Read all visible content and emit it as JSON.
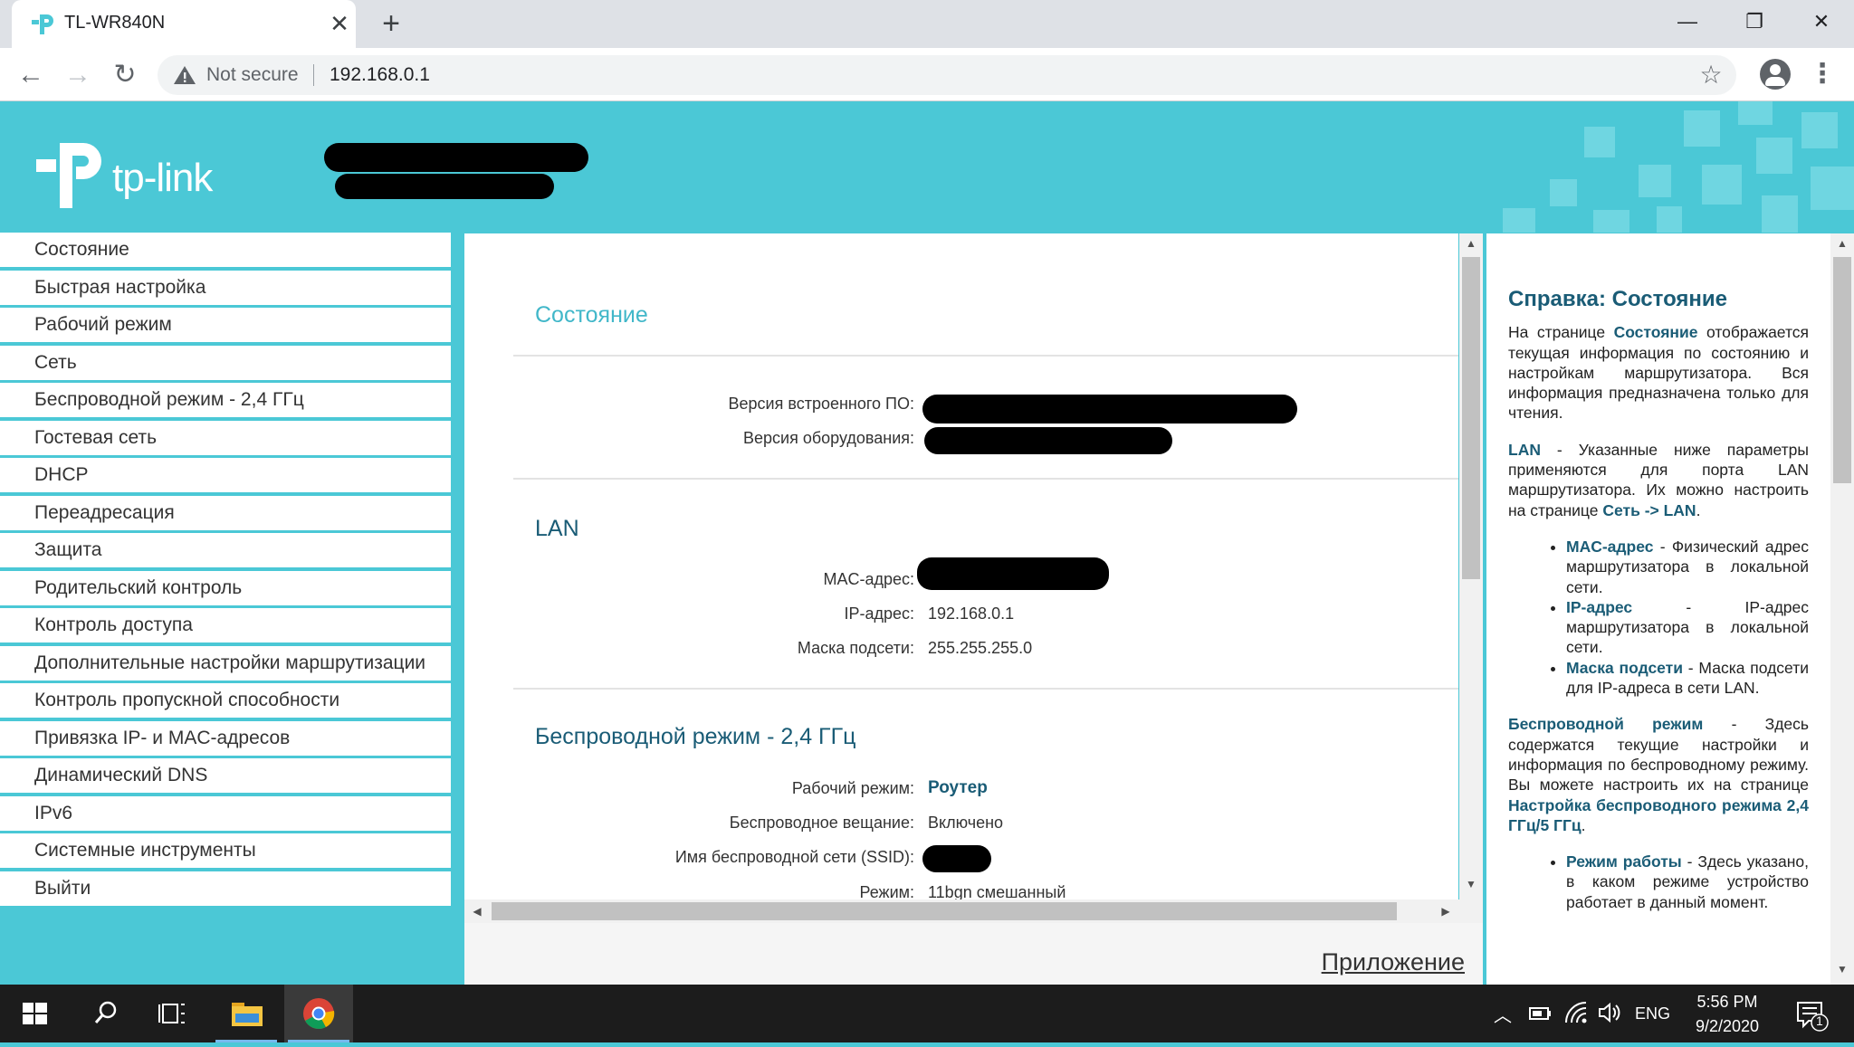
{
  "browser": {
    "tab_title": "TL-WR840N",
    "tab_close": "✕",
    "new_tab": "+",
    "security_label": "Not secure",
    "url": "192.168.0.1",
    "window_minimize": "—",
    "window_restore": "❐",
    "window_close": "✕"
  },
  "header": {
    "logo_text": "tp-link"
  },
  "sidebar": {
    "items": [
      {
        "label": "Состояние"
      },
      {
        "label": "Быстрая настройка"
      },
      {
        "label": "Рабочий режим"
      },
      {
        "label": "Сеть"
      },
      {
        "label": "Беспроводной режим - 2,4 ГГц"
      },
      {
        "label": "Гостевая сеть"
      },
      {
        "label": "DHCP"
      },
      {
        "label": "Переадресация"
      },
      {
        "label": "Защита"
      },
      {
        "label": "Родительский контроль"
      },
      {
        "label": "Контроль доступа"
      },
      {
        "label": "Дополнительные настройки маршрутизации"
      },
      {
        "label": "Контроль пропускной способности"
      },
      {
        "label": "Привязка IP- и MAC-адресов"
      },
      {
        "label": "Динамический DNS"
      },
      {
        "label": "IPv6"
      },
      {
        "label": "Системные инструменты"
      },
      {
        "label": "Выйти"
      }
    ]
  },
  "content": {
    "status_title": "Состояние",
    "firmware_label": "Версия встроенного ПО:",
    "hardware_label": "Версия оборудования:",
    "lan_title": "LAN",
    "mac_label": "MAC-адрес:",
    "ip_label": "IP-адрес:",
    "ip_value": "192.168.0.1",
    "mask_label": "Маска подсети:",
    "mask_value": "255.255.255.0",
    "wireless_title": "Беспроводной режим - 2,4 ГГц",
    "mode_label": "Рабочий режим:",
    "mode_value": "Роутер",
    "broadcast_label": "Беспроводное вещание:",
    "broadcast_value": "Включено",
    "ssid_label": "Имя беспроводной сети (SSID):",
    "wmode_label": "Режим:",
    "wmode_value": "11bgn смешанный",
    "appendix": "Приложение"
  },
  "help": {
    "title": "Справка: Состояние",
    "p1_a": "На странице ",
    "p1_b": "Состояние",
    "p1_c": " отображается текущая информация по состоянию и настройкам маршрутизатора. Вся информация предназначена только для чтения.",
    "p2_a": "LAN",
    "p2_b": " - Указанные ниже параметры применяются для порта LAN маршрутизатора. Их можно настроить на странице ",
    "p2_c": "Сеть -> LAN",
    "p2_d": ".",
    "li1_a": "MAC-адрес",
    "li1_b": " - Физический адрес маршрутизатора в локальной сети.",
    "li2_a": "IP-адрес",
    "li2_b": " - IP-адрес маршрутизатора в локальной сети.",
    "li3_a": "Маска подсети",
    "li3_b": " - Маска подсети для IP-адреса в сети LAN.",
    "p3_a": "Беспроводной режим",
    "p3_b": " - Здесь содержатся текущие настройки и информация по беспроводному режиму. Вы можете настроить их на странице ",
    "p3_c": "Настройка беспроводного режима 2,4 ГГц/5 ГГц",
    "p3_d": ".",
    "li4_a": "Режим работы",
    "li4_b": " - Здесь указано, в каком режиме устройство работает в данный момент."
  },
  "taskbar": {
    "lang": "ENG",
    "time": "5:56 PM",
    "date": "9/2/2020",
    "notif_count": "1"
  },
  "colors": {
    "brand_teal": "#4bc8d6",
    "heading_dark": "#1a5c76",
    "heading_accent": "#41b7c9"
  }
}
